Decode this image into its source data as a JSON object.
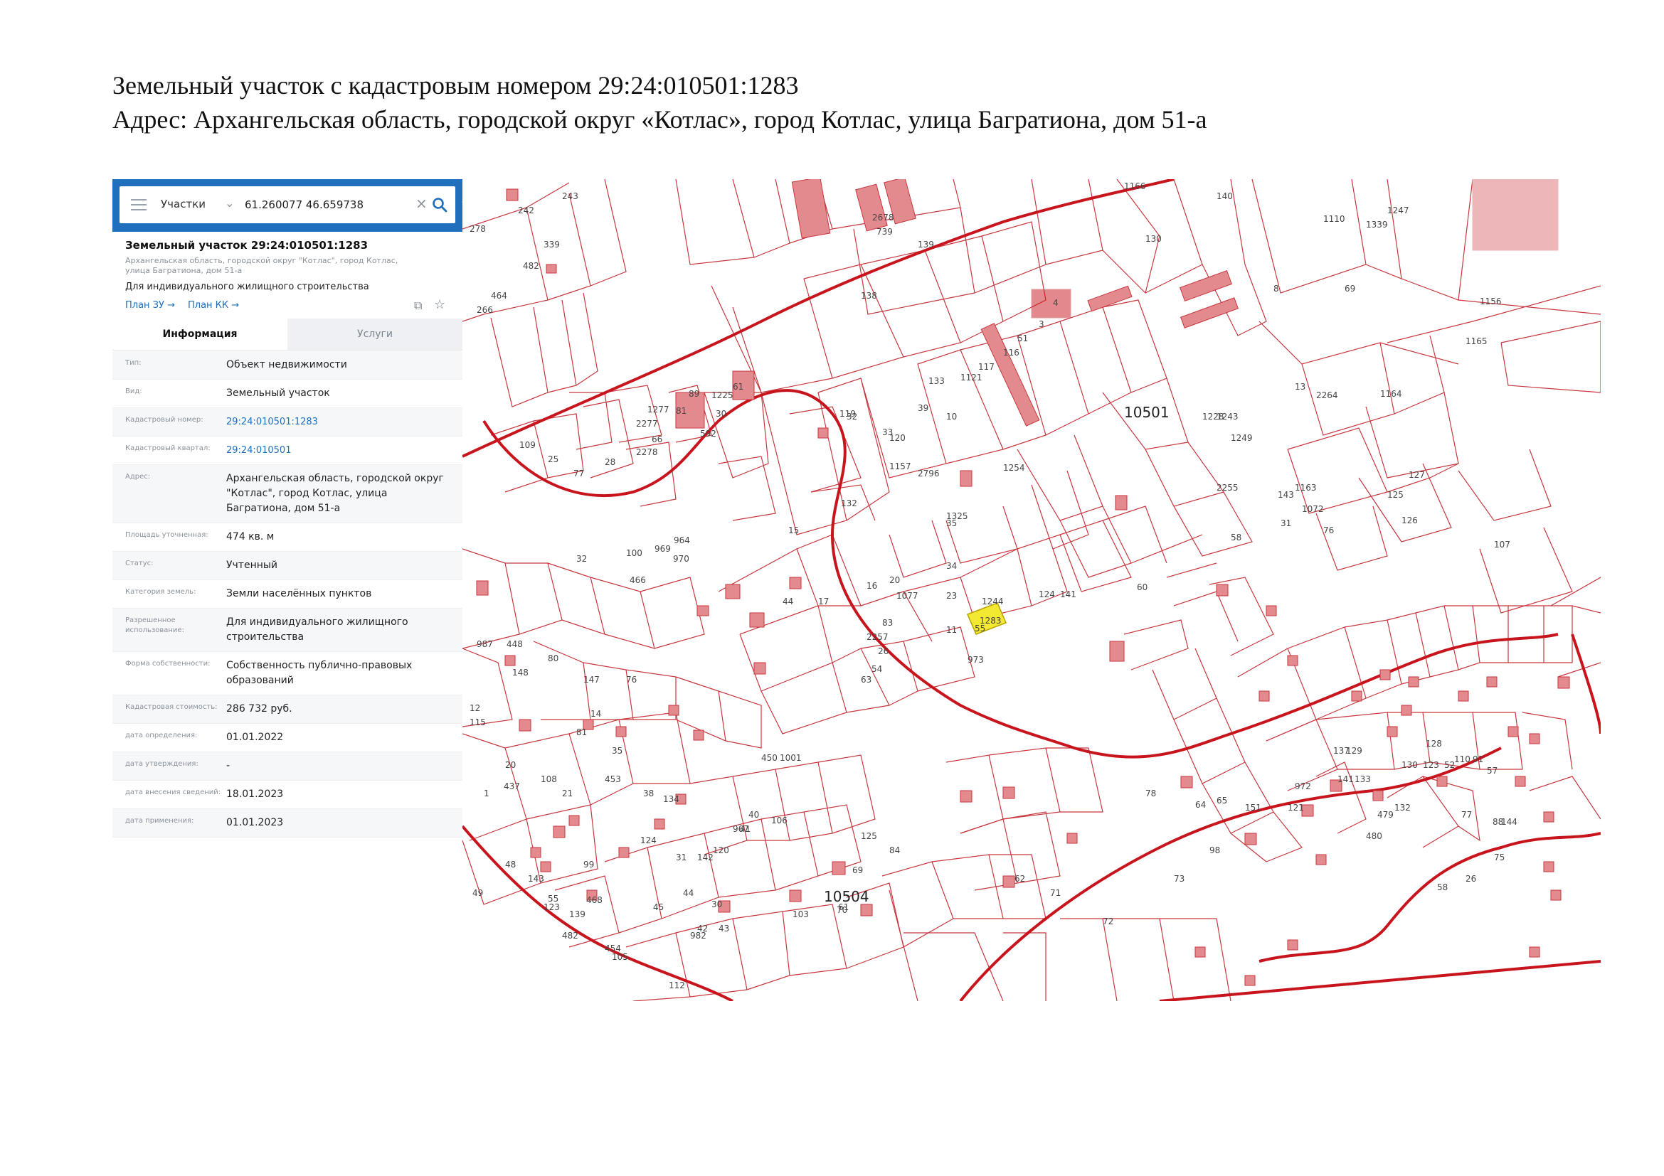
{
  "heading": {
    "line1": "Земельный участок с кадастровым номером 29:24:010501:1283",
    "line2": "Адрес: Архангельская область, городской округ «Котлас», город Котлас, улица Багратиона, дом 51-а"
  },
  "search": {
    "layer": "Участки",
    "query": "61.260077 46.659738"
  },
  "object": {
    "title": "Земельный участок 29:24:010501:1283",
    "address": "Архангельская область, городской округ \"Котлас\", город Котлас, улица Багратиона, дом 51-а",
    "purpose": "Для индивидуального жилищного строительства",
    "link_plan_zu": "План ЗУ →",
    "link_plan_kk": "План КК →"
  },
  "tabs": {
    "info": "Информация",
    "services": "Услуги"
  },
  "rows": [
    {
      "key": "Тип:",
      "value": "Объект недвижимости"
    },
    {
      "key": "Вид:",
      "value": "Земельный участок"
    },
    {
      "key": "Кадастровый номер:",
      "value": "29:24:010501:1283"
    },
    {
      "key": "Кадастровый квартал:",
      "value": "29:24:010501"
    },
    {
      "key": "Адрес:",
      "value": "Архангельская область, городской округ \"Котлас\", город Котлас, улица Багратиона, дом 51-а"
    },
    {
      "key": "Площадь уточненная:",
      "value": "474 кв. м"
    },
    {
      "key": "Статус:",
      "value": "Учтенный"
    },
    {
      "key": "Категория земель:",
      "value": "Земли населённых пунктов"
    },
    {
      "key": "Разрешенное использование:",
      "value": "Для индивидуального жилищного строительства"
    },
    {
      "key": "Форма собственности:",
      "value": "Собственность публично-правовых образований"
    },
    {
      "key": "Кадастровая стоимость:",
      "value": "286 732 руб."
    },
    {
      "key": "дата определения:",
      "value": "01.01.2022"
    },
    {
      "key": "дата утверждения:",
      "value": "-"
    },
    {
      "key": "дата внесения сведений:",
      "value": "18.01.2023"
    },
    {
      "key": "дата применения:",
      "value": "01.01.2023"
    }
  ],
  "map": {
    "quarter_labels": [
      "10501",
      "10504"
    ],
    "selected_parcel": "1283",
    "parcel_labels": [
      "243",
      "242",
      "278",
      "339",
      "482",
      "464",
      "266",
      "2678",
      "739",
      "139",
      "1166",
      "130",
      "140",
      "1110",
      "1339",
      "1247",
      "8",
      "69",
      "1156",
      "1165",
      "138",
      "4",
      "3",
      "51",
      "116",
      "117",
      "1121",
      "133",
      "10501",
      "1228",
      "1243",
      "1249",
      "13",
      "2264",
      "1164",
      "61",
      "89",
      "1225",
      "1277",
      "81",
      "30",
      "66",
      "109",
      "25",
      "77",
      "28",
      "2277",
      "2278",
      "592",
      "119",
      "32",
      "33",
      "39",
      "10",
      "120",
      "1163",
      "127",
      "125",
      "126",
      "107",
      "1157",
      "2796",
      "1325",
      "1254",
      "2255",
      "143",
      "1072",
      "31",
      "58",
      "76",
      "132",
      "15",
      "35",
      "34",
      "100",
      "969",
      "964",
      "970",
      "32",
      "466",
      "20",
      "16",
      "1077",
      "23",
      "1244",
      "124",
      "141",
      "60",
      "44",
      "17",
      "83",
      "11",
      "55",
      "2257",
      "26",
      "63",
      "54",
      "973",
      "987",
      "448",
      "148",
      "80",
      "147",
      "115",
      "12",
      "1",
      "20",
      "437",
      "108",
      "21",
      "76",
      "14",
      "81",
      "35",
      "453",
      "38",
      "134",
      "450",
      "1001",
      "40",
      "967",
      "120",
      "41",
      "42",
      "43",
      "44",
      "45",
      "982",
      "30",
      "31",
      "142",
      "124",
      "99",
      "48",
      "143",
      "49",
      "123",
      "55",
      "139",
      "468",
      "482",
      "105",
      "112",
      "454",
      "103",
      "61",
      "84",
      "70",
      "106",
      "125",
      "69",
      "62",
      "71",
      "72",
      "73",
      "98",
      "78",
      "64",
      "65",
      "151",
      "121",
      "972",
      "141",
      "480",
      "479",
      "132",
      "137",
      "129",
      "133",
      "130",
      "128",
      "123",
      "110",
      "52",
      "91",
      "57",
      "77",
      "88",
      "144",
      "75",
      "26",
      "58",
      "10504"
    ]
  }
}
